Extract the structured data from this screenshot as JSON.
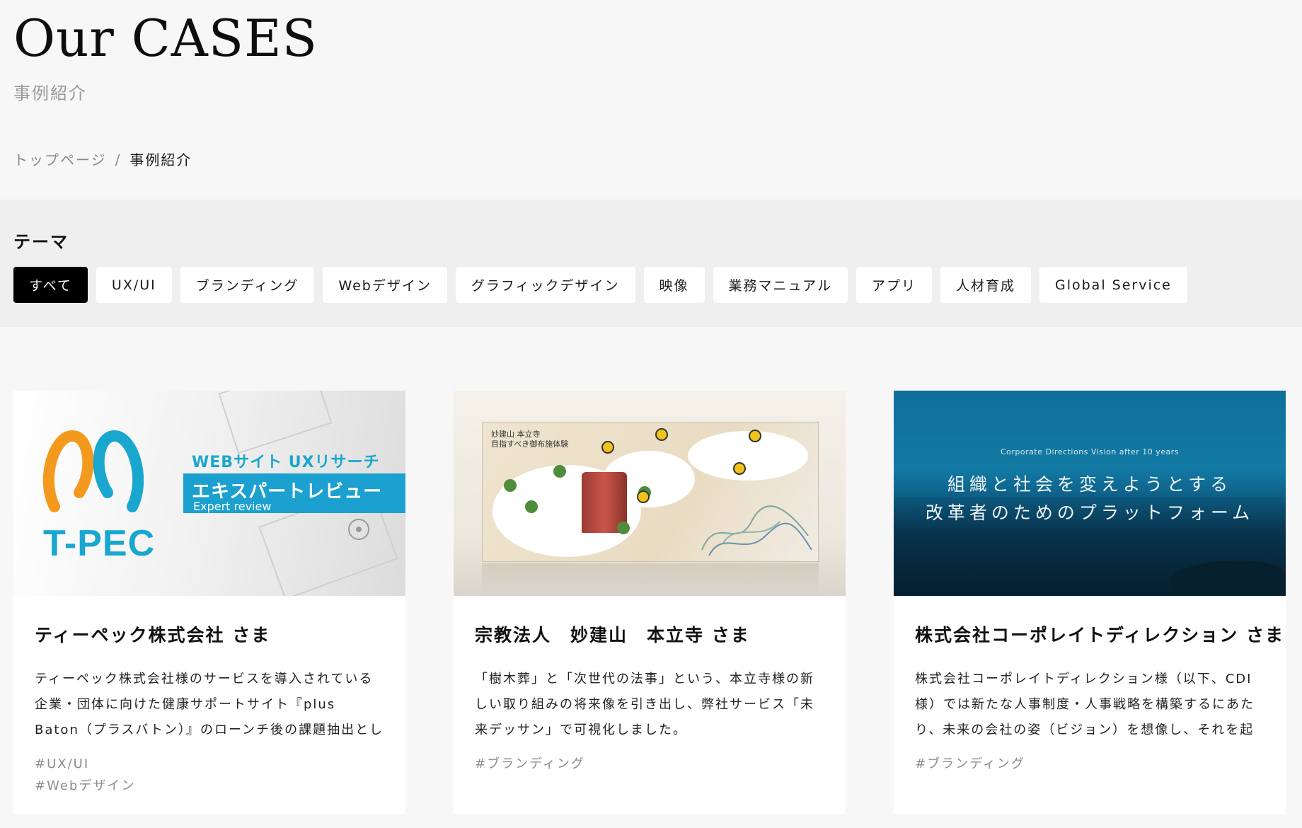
{
  "header": {
    "title": "Our CASES",
    "subtitle": "事例紹介"
  },
  "breadcrumb": {
    "home": "トップページ",
    "separator": "/",
    "current": "事例紹介"
  },
  "themes": {
    "label": "テーマ",
    "tags": [
      {
        "label": "すべて",
        "active": true
      },
      {
        "label": "UX/UI"
      },
      {
        "label": "ブランディング"
      },
      {
        "label": "Webデザイン"
      },
      {
        "label": "グラフィックデザイン"
      },
      {
        "label": "映像"
      },
      {
        "label": "業務マニュアル"
      },
      {
        "label": "アプリ"
      },
      {
        "label": "人材育成"
      },
      {
        "label": "Global Service"
      }
    ]
  },
  "cards": [
    {
      "title": "ティーペック株式会社 さま",
      "description": "ティーペック株式会社様のサービスを導入されている企業・団体に向けた健康サポートサイト『plus Baton（プラスバトン）』のローンチ後の課題抽出としてエキスパ…",
      "tags": [
        "#UX/UI",
        "#Webデザイン"
      ],
      "image": {
        "logo_text": "T-PEC",
        "headline": "WEBサイト UXリサーチ",
        "banner": "エキスパートレビュー",
        "banner_sub": "Expert review"
      }
    },
    {
      "title": "宗教法人　妙建山　本立寺 さま",
      "description": "「樹木葬」と「次世代の法事」という、本立寺様の新しい取り組みの将来像を引き出し、弊社サービス「未来デッサン」で可視化しました。",
      "tags": [
        "#ブランディング"
      ],
      "image": {
        "caption_line1": "妙建山 本立寺",
        "caption_line2": "目指すべき御布施体験"
      }
    },
    {
      "title": "株式会社コーポレイトディレクション さま",
      "description": "株式会社コーポレイトディレクション様（以下、CDI様）では新たな人事制度・人事戦略を構築するにあたり、未来の会社の姿（ビジョン）を想像し、それを起点として…",
      "tags": [
        "#ブランディング"
      ],
      "image": {
        "small_caption": "Corporate Directions Vision after 10 years",
        "line1": "組織と社会を変えようとする",
        "line2": "改革者のためのプラットフォーム"
      }
    }
  ],
  "colors": {
    "page_bg": "#f7f7f7",
    "band_bg": "#efefef",
    "active_tag_bg": "#000000",
    "tpec_blue": "#1aa7cf",
    "tag_gray": "#8c8c8c"
  }
}
